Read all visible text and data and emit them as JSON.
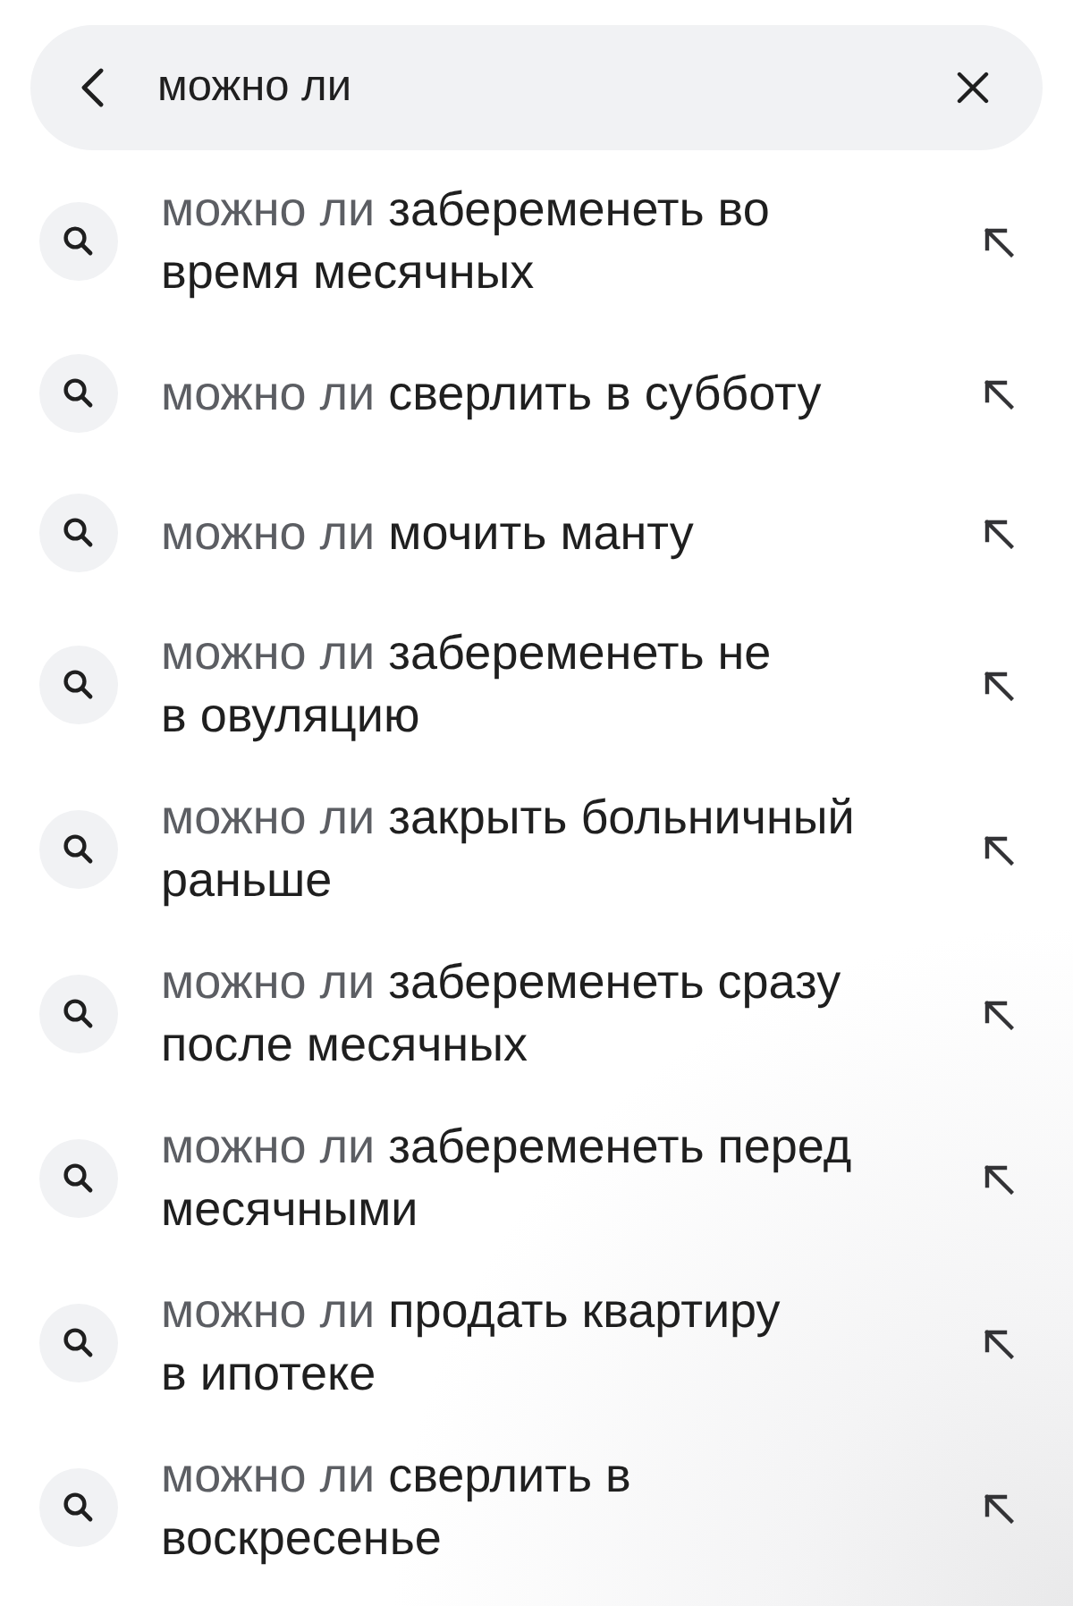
{
  "search": {
    "value": "можно ли"
  },
  "suggestions": [
    {
      "prefix": "можно ли",
      "completion": "забеременеть во\nвремя месячных"
    },
    {
      "prefix": "можно ли",
      "completion": "сверлить в субботу"
    },
    {
      "prefix": "можно ли",
      "completion": "мочить манту"
    },
    {
      "prefix": "можно ли",
      "completion": "забеременеть не\nв овуляцию"
    },
    {
      "prefix": "можно ли",
      "completion": "закрыть больничный\nраньше"
    },
    {
      "prefix": "можно ли",
      "completion": "забеременеть сразу\nпосле месячных"
    },
    {
      "prefix": "можно ли",
      "completion": "забеременеть перед\nмесячными"
    },
    {
      "prefix": "можно ли",
      "completion": "продать квартиру\nв ипотеке"
    },
    {
      "prefix": "можно ли",
      "completion": "сверлить в\nвоскресенье"
    }
  ]
}
